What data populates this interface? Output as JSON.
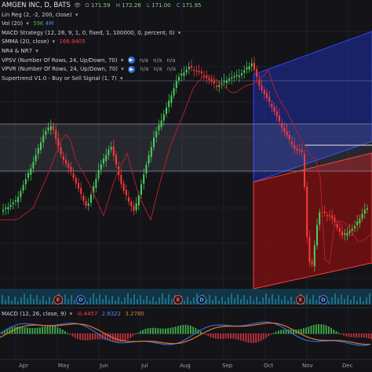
{
  "header": {
    "symbol_title": "AMGEN INC, D, BATS",
    "ohlc": [
      {
        "label": "O",
        "value": "171.59"
      },
      {
        "label": "H",
        "value": "172.26"
      },
      {
        "label": "L",
        "value": "171.00"
      },
      {
        "label": "C",
        "value": "171.95"
      }
    ]
  },
  "indicators": {
    "linreg": "Lin Reg (2, -2, 200, close)",
    "vol_label": "Vol (20)",
    "vol_value": "59K",
    "vol_ma": "4M",
    "macd_strategy": "MACD Strategy (12, 26, 9, 1, 0, fixed, 1, 100000, 0, percent, 0)",
    "smma_label": "SMMA (20, close)",
    "smma_value": "166.9405",
    "nr": "NR4 & NR7",
    "vpsv": "VPSV (Number Of Rows, 24, Up/Down, 70)",
    "vpvr": "VPVR (Number Of Rows, 24, Up/Down, 70)",
    "na": "n/a",
    "supertrend": "Supertrend V1.0 - Buy or Sell Signal (1, 7)"
  },
  "macd": {
    "label": "MACD (12, 26, close, 9)",
    "v1": "-0.4457",
    "v2": "2.8322",
    "v3": "3.2780"
  },
  "events": [
    "E",
    "D",
    "E",
    "D",
    "E",
    "D"
  ],
  "x_axis": [
    "Apr",
    "May",
    "Jun",
    "Jul",
    "Aug",
    "Sep",
    "Oct",
    "Nov",
    "Dec"
  ],
  "colors": {
    "up": "#4bd05a",
    "down": "#ff3b3b",
    "background": "#131318",
    "channel_blue": "#1f2fa8",
    "channel_red": "#8c1010",
    "smma": "#b0202a",
    "macd_line": "#2f6fd8",
    "signal_line": "#e8762c"
  }
}
